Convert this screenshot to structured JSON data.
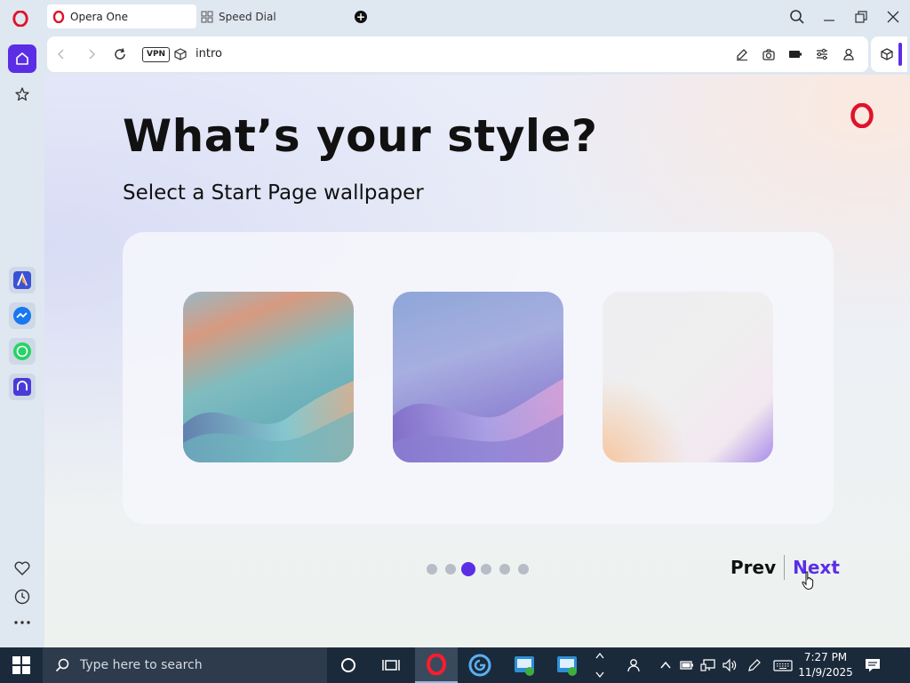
{
  "browser": {
    "tabs": [
      {
        "label": "Opera One",
        "active": true
      },
      {
        "label": "Speed Dial",
        "active": false
      }
    ],
    "address": {
      "vpn_label": "VPN",
      "url": "intro"
    },
    "accent_color": "#5b2ee6"
  },
  "page": {
    "title": "What’s your style?",
    "subtitle": "Select a Start Page wallpaper",
    "wallpapers": [
      "aurora-warm",
      "aurora-violet",
      "soft-pastel"
    ],
    "pager": {
      "total": 6,
      "current": 3
    },
    "prev_label": "Prev",
    "next_label": "Next"
  },
  "taskbar": {
    "search_placeholder": "Type here to search",
    "time": "7:27 PM",
    "date": "11/9/2025"
  }
}
